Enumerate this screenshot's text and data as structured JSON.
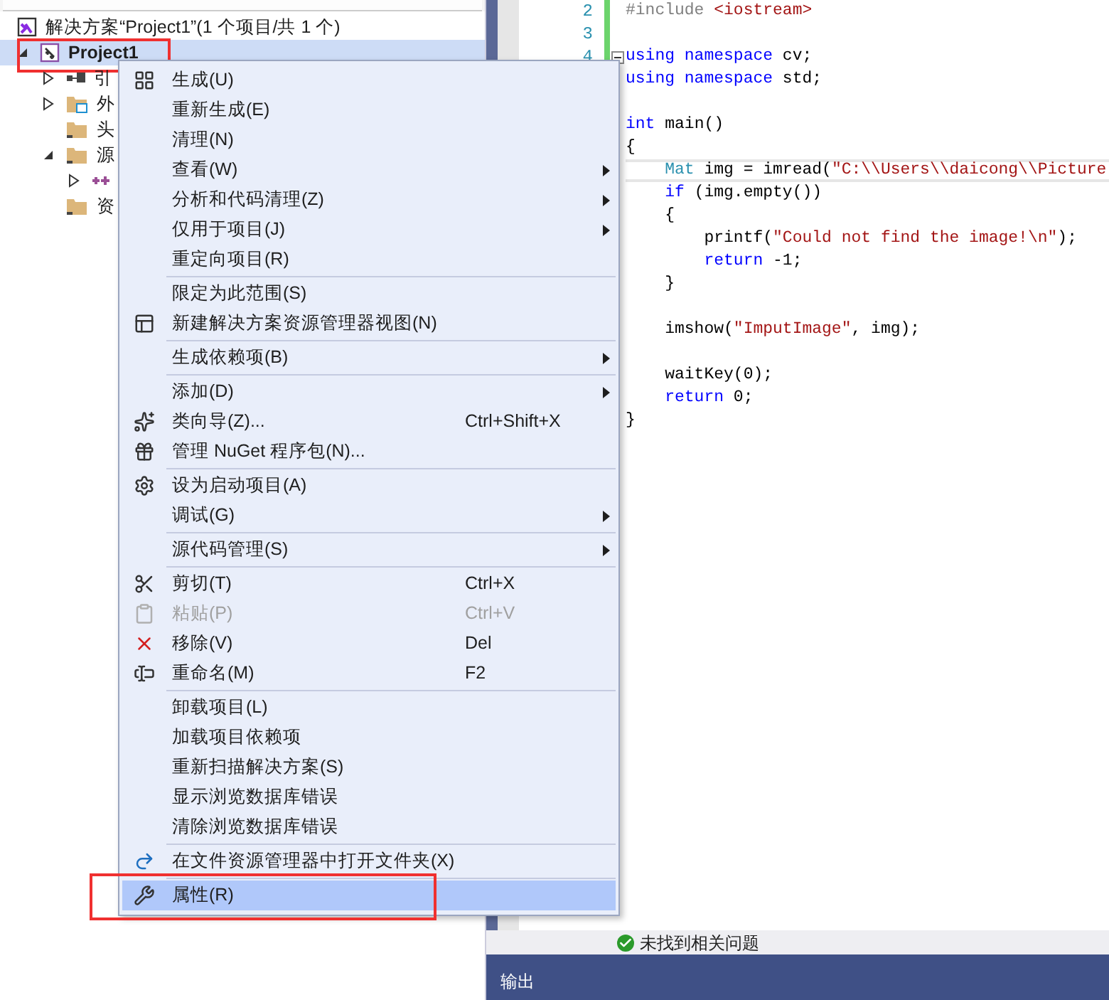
{
  "solution_explorer": {
    "tree": [
      {
        "kind": "solution",
        "label": "解决方案“Project1”(1 个项目/共 1 个)",
        "selected": false,
        "children": [
          {
            "kind": "project",
            "label": "Project1",
            "expanded": true,
            "selected": true,
            "annotated": true,
            "children": [
              {
                "kind": "references",
                "label": "引",
                "expanded": false,
                "selected": false
              },
              {
                "kind": "external",
                "label": "外",
                "expanded": false,
                "selected": false
              },
              {
                "kind": "folder",
                "label": "头",
                "selected": false
              },
              {
                "kind": "folder",
                "label": "源",
                "expanded": true,
                "selected": false,
                "children": [
                  {
                    "kind": "source-file",
                    "expanded": false,
                    "selected": false
                  }
                ]
              },
              {
                "kind": "folder",
                "label": "资",
                "selected": false
              }
            ]
          }
        ]
      }
    ]
  },
  "editor": {
    "lines": [
      {
        "number": "2",
        "changed": true,
        "tokens": [
          {
            "kind": "preprocessor",
            "text": "#include "
          },
          {
            "kind": "string",
            "text": "<iostream>"
          }
        ]
      },
      {
        "number": "3",
        "changed": true
      },
      {
        "number": "4",
        "changed": true,
        "fold": true,
        "tokens": [
          {
            "kind": "keyword",
            "text": "using namespace"
          },
          {
            "kind": "plain",
            "text": " cv;"
          }
        ]
      },
      {
        "tokens": [
          {
            "kind": "keyword",
            "text": "using namespace"
          },
          {
            "kind": "plain",
            "text": " std;"
          }
        ]
      },
      {
        "gap_before": true,
        "tokens": [
          {
            "kind": "keyword",
            "text": "int"
          },
          {
            "kind": "plain",
            "text": " main()"
          }
        ]
      },
      {
        "tokens": [
          {
            "kind": "plain",
            "text": "{"
          }
        ]
      },
      {
        "current": true,
        "tokens": [
          {
            "kind": "type",
            "text": "    Mat"
          },
          {
            "kind": "plain",
            "text": " img = imread("
          },
          {
            "kind": "string",
            "text": "\"C:\\\\Users\\\\daicong\\\\Picture"
          }
        ]
      },
      {
        "tokens": [
          {
            "kind": "keyword",
            "text": "    if"
          },
          {
            "kind": "plain",
            "text": " (img.empty())"
          }
        ]
      },
      {
        "tokens": [
          {
            "kind": "plain",
            "text": "    {"
          }
        ]
      },
      {
        "tokens": [
          {
            "kind": "plain",
            "text": "        printf("
          },
          {
            "kind": "string",
            "text": "\"Could not find the image!\\n\""
          },
          {
            "kind": "plain",
            "text": ");"
          }
        ]
      },
      {
        "tokens": [
          {
            "kind": "keyword",
            "text": "        return"
          },
          {
            "kind": "plain",
            "text": " -1;"
          }
        ]
      },
      {
        "tokens": [
          {
            "kind": "plain",
            "text": "    }"
          }
        ]
      },
      {
        "gap_before": true,
        "tokens": [
          {
            "kind": "plain",
            "text": "    imshow("
          },
          {
            "kind": "string",
            "text": "\"ImputImage\""
          },
          {
            "kind": "plain",
            "text": ", img);"
          }
        ]
      },
      {
        "gap_before": true,
        "tokens": [
          {
            "kind": "plain",
            "text": "    waitKey(0);"
          }
        ]
      },
      {
        "tokens": [
          {
            "kind": "keyword",
            "text": "    return"
          },
          {
            "kind": "plain",
            "text": " 0;"
          }
        ]
      },
      {
        "tokens": [
          {
            "kind": "plain",
            "text": "}"
          }
        ]
      }
    ]
  },
  "status_bar": {
    "issues": "未找到相关问题"
  },
  "bottom_panel": {
    "tab": "输出"
  },
  "context_menu": {
    "groups": [
      [
        {
          "label": "生成(U)"
        },
        {
          "label": "重新生成(E)"
        },
        {
          "label": "清理(N)"
        },
        {
          "label": "查看(W)",
          "submenu": true
        },
        {
          "label": "分析和代码清理(Z)",
          "submenu": true
        },
        {
          "label": "仅用于项目(J)",
          "submenu": true
        },
        {
          "label": "重定向项目(R)"
        }
      ],
      [
        {
          "label": "限定为此范围(S)"
        },
        {
          "label": "新建解决方案资源管理器视图(N)"
        }
      ],
      [
        {
          "label": "生成依赖项(B)",
          "submenu": true
        }
      ],
      [
        {
          "label": "添加(D)",
          "submenu": true
        },
        {
          "label": "类向导(Z)...",
          "shortcut": "Ctrl+Shift+X"
        },
        {
          "label": "管理 NuGet 程序包(N)..."
        }
      ],
      [
        {
          "label": "设为启动项目(A)"
        },
        {
          "label": "调试(G)",
          "submenu": true
        }
      ],
      [
        {
          "label": "源代码管理(S)",
          "submenu": true
        }
      ],
      [
        {
          "label": "剪切(T)",
          "shortcut": "Ctrl+X"
        },
        {
          "label": "粘贴(P)",
          "shortcut": "Ctrl+V",
          "disabled": true
        },
        {
          "label": "移除(V)",
          "shortcut": "Del"
        },
        {
          "label": "重命名(M)",
          "shortcut": "F2"
        }
      ],
      [
        {
          "label": "卸载项目(L)"
        },
        {
          "label": "加载项目依赖项"
        },
        {
          "label": "重新扫描解决方案(S)"
        },
        {
          "label": "显示浏览数据库错误"
        },
        {
          "label": "清除浏览数据库错误"
        }
      ],
      [
        {
          "label": "在文件资源管理器中打开文件夹(X)"
        }
      ],
      [
        {
          "label": "属性(R)",
          "selected": true,
          "annotated": true
        }
      ]
    ]
  }
}
